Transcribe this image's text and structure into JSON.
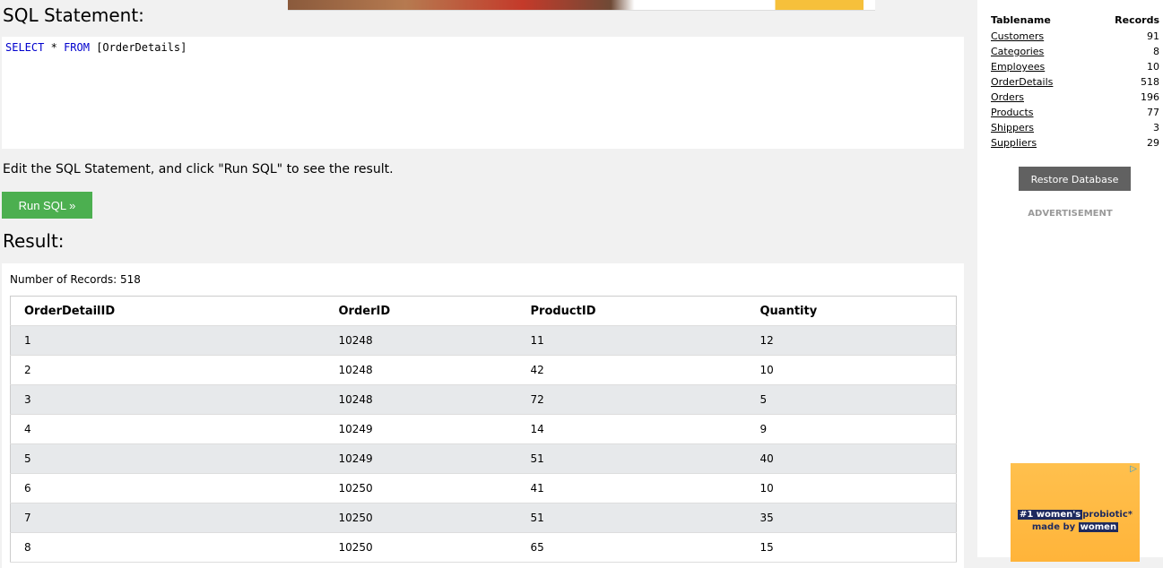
{
  "main": {
    "sql_title": "SQL Statement:",
    "sql_keyword_select": "SELECT",
    "sql_star": "*",
    "sql_keyword_from": "FROM",
    "sql_table": "[OrderDetails]",
    "hint": "Edit the SQL Statement, and click \"Run SQL\" to see the result.",
    "run_button": "Run SQL »",
    "result_title": "Result:",
    "record_count": "Number of Records: 518",
    "columns": [
      "OrderDetailID",
      "OrderID",
      "ProductID",
      "Quantity"
    ],
    "rows": [
      [
        "1",
        "10248",
        "11",
        "12"
      ],
      [
        "2",
        "10248",
        "42",
        "10"
      ],
      [
        "3",
        "10248",
        "72",
        "5"
      ],
      [
        "4",
        "10249",
        "14",
        "9"
      ],
      [
        "5",
        "10249",
        "51",
        "40"
      ],
      [
        "6",
        "10250",
        "41",
        "10"
      ],
      [
        "7",
        "10250",
        "51",
        "35"
      ],
      [
        "8",
        "10250",
        "65",
        "15"
      ]
    ]
  },
  "sidebar": {
    "header_name": "Tablename",
    "header_records": "Records",
    "tables": [
      {
        "name": "Customers",
        "records": "91"
      },
      {
        "name": "Categories",
        "records": "8"
      },
      {
        "name": "Employees",
        "records": "10"
      },
      {
        "name": "OrderDetails",
        "records": "518"
      },
      {
        "name": "Orders",
        "records": "196"
      },
      {
        "name": "Products",
        "records": "77"
      },
      {
        "name": "Shippers",
        "records": "3"
      },
      {
        "name": "Suppliers",
        "records": "29"
      }
    ],
    "restore_button": "Restore Database",
    "advertisement_label": "ADVERTISEMENT",
    "ad": {
      "line1_highlight": "#1 women's",
      "line1_plain": "probiotic*",
      "line2_plain": "made by",
      "line2_highlight": "women",
      "corner_icon": "ad-choices-icon"
    }
  },
  "colors": {
    "run_button": "#4caf50",
    "restore_button": "#616161",
    "sql_keyword": "#0000cd",
    "row_alt": "#e7e9eb"
  }
}
